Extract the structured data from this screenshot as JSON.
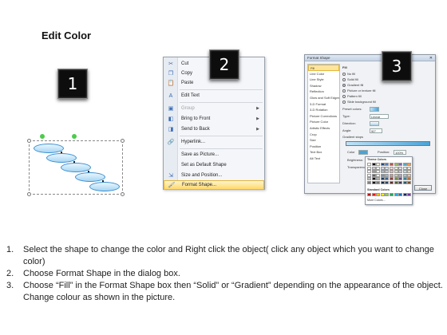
{
  "slide": {
    "title": "Edit Color"
  },
  "badges": [
    "1",
    "2",
    "3"
  ],
  "context_menu": {
    "items": [
      {
        "label": "Cut",
        "icon": "scissors-icon",
        "glyph": "✂"
      },
      {
        "label": "Copy",
        "icon": "copy-icon",
        "glyph": "❐"
      },
      {
        "label": "Paste",
        "icon": "paste-icon",
        "glyph": "📋"
      },
      {
        "label": "Edit Text",
        "icon": "edit-text-icon",
        "glyph": "A"
      },
      {
        "label": "Group",
        "icon": "group-icon",
        "glyph": "▣"
      },
      {
        "label": "Bring to Front",
        "icon": "bring-front-icon",
        "glyph": "◧"
      },
      {
        "label": "Send to Back",
        "icon": "send-back-icon",
        "glyph": "◨"
      },
      {
        "label": "Hyperlink...",
        "icon": "hyperlink-icon",
        "glyph": "🔗"
      },
      {
        "label": "Save as Picture...",
        "icon": "save-picture-icon",
        "glyph": ""
      },
      {
        "label": "Set as Default Shape",
        "icon": "default-shape-icon",
        "glyph": ""
      },
      {
        "label": "Size and Position...",
        "icon": "size-position-icon",
        "glyph": "⇲"
      },
      {
        "label": "Format Shape...",
        "icon": "format-shape-icon",
        "glyph": "🖌"
      }
    ]
  },
  "format_dialog": {
    "title": "Format Shape",
    "close_glyph": "✕",
    "nav": [
      "Fill",
      "Line Color",
      "Line Style",
      "Shadow",
      "Reflection",
      "Glow and Soft Edges",
      "3-D Format",
      "3-D Rotation",
      "Picture Corrections",
      "Picture Color",
      "Artistic Effects",
      "Crop",
      "Size",
      "Position",
      "Text Box",
      "Alt Text"
    ],
    "section": "Fill",
    "options": [
      "No fill",
      "Solid fill",
      "Gradient fill",
      "Picture or texture fill",
      "Pattern fill",
      "Slide background fill"
    ],
    "preset_label": "Preset colors:",
    "type_label": "Type:",
    "type_value": "Linear",
    "direction_label": "Direction:",
    "angle_label": "Angle:",
    "angle_value": "90°",
    "stops_label": "Gradient stops",
    "color_label": "Color",
    "position_label": "Position:",
    "position_value": "100%",
    "brightness_label": "Brightness:",
    "transparency_label": "Transparency:",
    "close_button": "Close"
  },
  "palette": {
    "theme_label": "Theme Colors",
    "standard_label": "Standard Colors",
    "more_label": "More Colors...",
    "theme_colors": [
      "#ffffff",
      "#000000",
      "#eeece1",
      "#1f497d",
      "#4f81bd",
      "#c0504d",
      "#9bbb59",
      "#8064a2",
      "#4bacc6",
      "#f79646"
    ],
    "standard_colors": [
      "#c00000",
      "#ff0000",
      "#ffc000",
      "#ffff00",
      "#92d050",
      "#00b050",
      "#00b0f0",
      "#0070c0",
      "#002060",
      "#7030a0"
    ]
  },
  "instructions": [
    {
      "num": "1.",
      "text": "Select the shape to change the color and Right click the object( click any object which you want to change color)"
    },
    {
      "num": "2.",
      "text": "Choose Format Shape in the dialog box."
    },
    {
      "num": "3.",
      "text": "Choose “Fill” in the Format Shape box then “Solid” or “Gradient” depending on the appearance of the object. Change colour as shown in the picture."
    }
  ]
}
